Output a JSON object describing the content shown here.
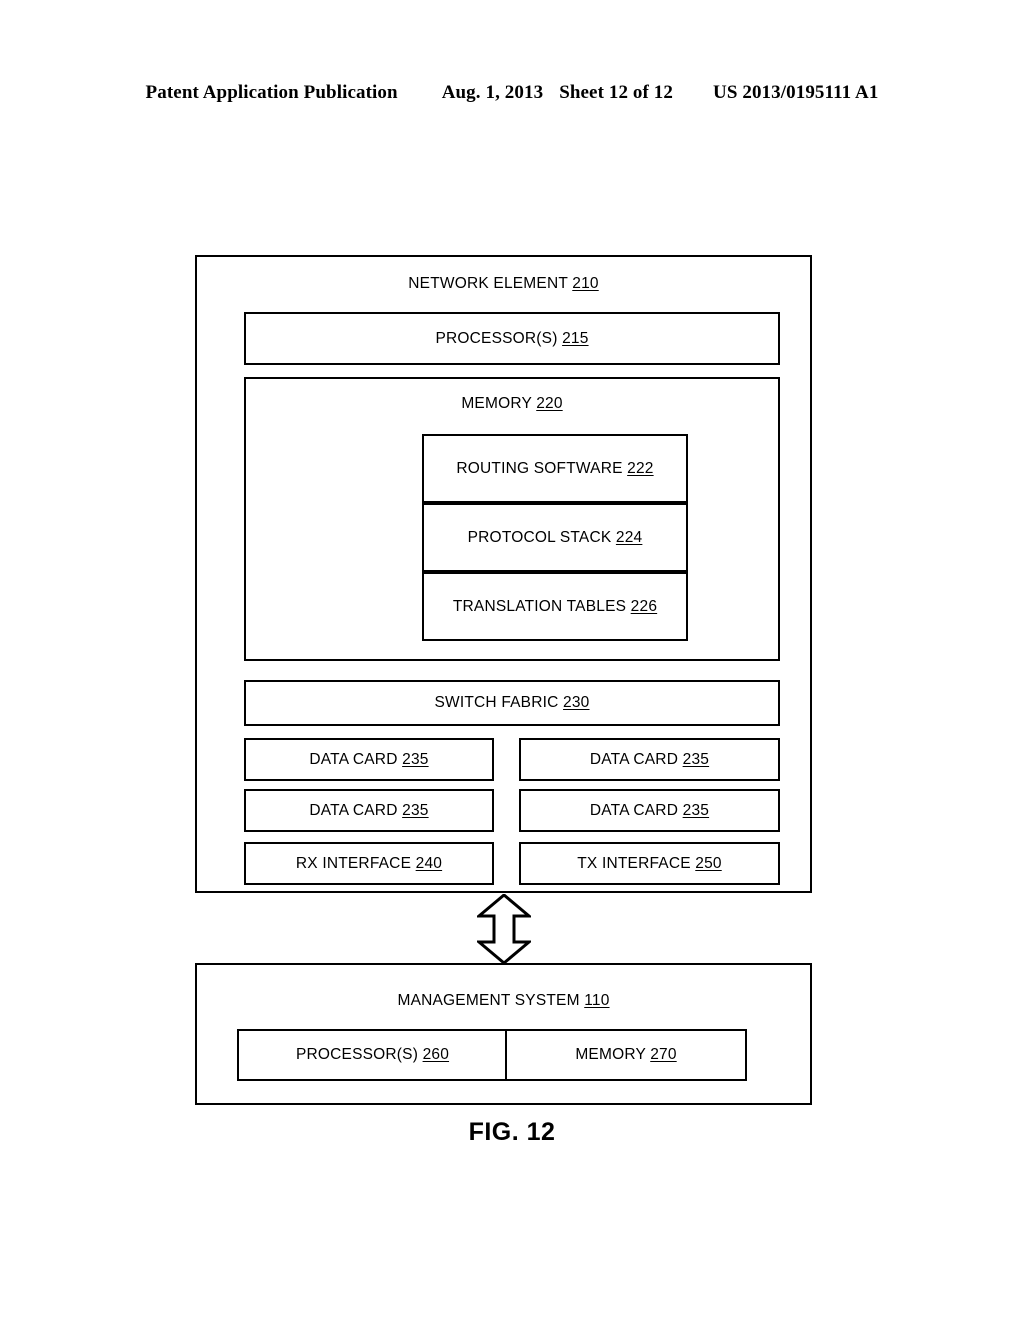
{
  "header": {
    "publication": "Patent Application Publication",
    "date": "Aug. 1, 2013",
    "sheet": "Sheet 12 of 12",
    "patent_number": "US 2013/0195111 A1"
  },
  "figure": {
    "caption": "FIG. 12",
    "network_element": {
      "label": "NETWORK ELEMENT",
      "ref": "210",
      "processor": {
        "label": "PROCESSOR(S)",
        "ref": "215"
      },
      "memory": {
        "label": "MEMORY",
        "ref": "220",
        "items": [
          {
            "label": "ROUTING SOFTWARE",
            "ref": "222"
          },
          {
            "label": "PROTOCOL STACK",
            "ref": "224"
          },
          {
            "label": "TRANSLATION TABLES",
            "ref": "226"
          }
        ]
      },
      "switch_fabric": {
        "label": "SWITCH FABRIC",
        "ref": "230"
      },
      "cards": [
        {
          "label": "DATA CARD",
          "ref": "235"
        },
        {
          "label": "DATA CARD",
          "ref": "235"
        },
        {
          "label": "DATA CARD",
          "ref": "235"
        },
        {
          "label": "DATA CARD",
          "ref": "235"
        },
        {
          "label": "RX INTERFACE",
          "ref": "240"
        },
        {
          "label": "TX INTERFACE",
          "ref": "250"
        }
      ]
    },
    "link": {
      "icon": "double-headed-vertical-arrow-icon"
    },
    "management_system": {
      "label": "MANAGEMENT SYSTEM",
      "ref": "110",
      "processor": {
        "label": "PROCESSOR(S)",
        "ref": "260"
      },
      "memory": {
        "label": "MEMORY",
        "ref": "270"
      }
    }
  },
  "colors": {
    "ink": "#000000",
    "paper": "#ffffff"
  }
}
